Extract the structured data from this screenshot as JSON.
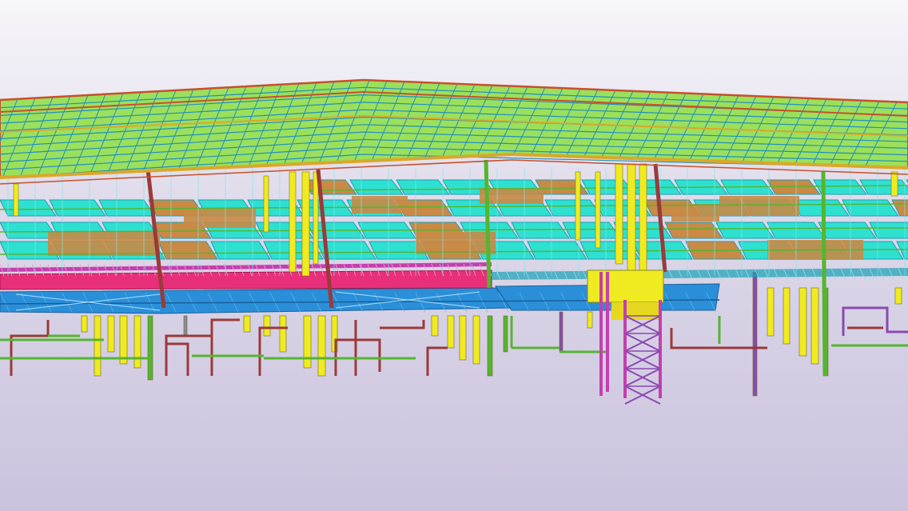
{
  "viewport": {
    "background": {
      "top": "#f7f6fa",
      "middle": "#dcd7e8",
      "bottom": "#cbc3de"
    },
    "model": {
      "colors": {
        "roof_fill": "#9be05a",
        "roof_grid": "#1f8fbf",
        "roof_frame": "#c8502c",
        "roof_edge": "#d9a82a",
        "slab": "#2ee0d0",
        "slab_dark": "#1a9fb5",
        "deck_brown": "#c88a45",
        "pink_truss": "#e8307a",
        "magenta": "#c43fb0",
        "blue_deck": "#2a8fd8",
        "yellow": "#f0ea20",
        "green": "#55b52e",
        "maroon": "#9a3a3a",
        "purple": "#8a4ab0",
        "gray": "#8a8a9a",
        "cyan_line": "#7fe8ec"
      }
    }
  }
}
